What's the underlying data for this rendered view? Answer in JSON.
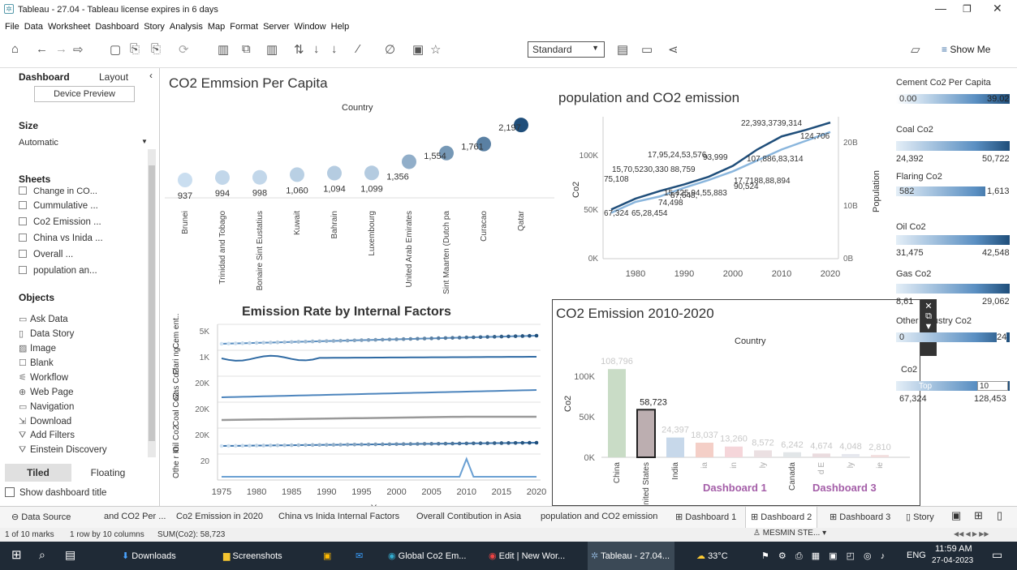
{
  "window": {
    "title": "Tableau - 27.04 - Tableau license expires in 6 days"
  },
  "menu": [
    "File",
    "Data",
    "Worksheet",
    "Dashboard",
    "Story",
    "Analysis",
    "Map",
    "Format",
    "Server",
    "Window",
    "Help"
  ],
  "toolbar": {
    "view_select": "Standard",
    "show_me": "Show Me"
  },
  "left": {
    "tab_dashboard": "Dashboard",
    "tab_layout": "Layout",
    "device_preview": "Device Preview",
    "size_h": "Size",
    "size_val": "Automatic",
    "sheets_h": "Sheets",
    "sheets": [
      "Change in CO...",
      "Cummulative ...",
      "Co2 Emission ...",
      "China vs Inida ...",
      "Overall ...",
      "population an..."
    ],
    "objects_h": "Objects",
    "objects": [
      {
        "icon": "ask-data-icon",
        "label": "Ask Data"
      },
      {
        "icon": "data-story-icon",
        "label": "Data Story"
      },
      {
        "icon": "image-icon",
        "label": "Image"
      },
      {
        "icon": "blank-icon",
        "label": "Blank"
      },
      {
        "icon": "workflow-icon",
        "label": "Workflow"
      },
      {
        "icon": "web-page-icon",
        "label": "Web Page"
      },
      {
        "icon": "navigation-icon",
        "label": "Navigation"
      },
      {
        "icon": "download-icon",
        "label": "Download"
      },
      {
        "icon": "add-filters-icon",
        "label": "Add Filters"
      },
      {
        "icon": "einstein-icon",
        "label": "Einstein Discovery"
      }
    ],
    "tiled": "Tiled",
    "floating": "Floating",
    "show_title": "Show dashboard title"
  },
  "chart1": {
    "title": "CO2 Emmsion Per Capita",
    "header": "Country"
  },
  "chart2": {
    "title": "population and CO2 emission",
    "ylabel": "Co2",
    "y2label": "Population"
  },
  "chart3": {
    "title": "Emission Rate by Internal Factors",
    "xlabel": "Year"
  },
  "chart4": {
    "title": "CO2 Emission 2010-2020",
    "header": "Country",
    "ylabel": "Co2",
    "overlay1": "Dashboard 1",
    "overlay2": "Dashboard 3"
  },
  "chart_data": [
    {
      "type": "scatter",
      "title": "CO2 Emmsion Per Capita",
      "categories": [
        "Brunei",
        "Trinidad and Tobago",
        "Bonaire Sint Eustatius and Saba",
        "Kuwait",
        "Bahrain",
        "Luxembourg",
        "United Arab Emirates",
        "Sint Maarten (Dutch part)",
        "Curacao",
        "Qatar"
      ],
      "values": [
        937,
        994,
        998,
        1060,
        1094,
        1099,
        1356,
        1554,
        1761,
        2197
      ],
      "labels": [
        "937",
        "994",
        "998",
        "1,060",
        "1,094",
        "1,099",
        "1,356",
        "1,554",
        "1,761",
        "2,197"
      ]
    },
    {
      "type": "line",
      "title": "population and CO2 emission",
      "x": [
        1975,
        1980,
        1985,
        1990,
        1995,
        2000,
        2005,
        2010,
        2015,
        2020
      ],
      "xticks": [
        "1980",
        "1990",
        "2000",
        "2010",
        "2020"
      ],
      "yticks": [
        "0K",
        "50K",
        "100K"
      ],
      "y2ticks": [
        "0B",
        "10B",
        "20B"
      ],
      "ylim": [
        0,
        130000
      ],
      "series": [
        {
          "values": [
            45000,
            55000,
            62000,
            68000,
            75000,
            85000,
            100000,
            112000,
            118000,
            124706
          ]
        },
        {
          "values": [
            42000,
            52000,
            57000,
            65000,
            72000,
            80000,
            90000,
            100000,
            108000,
            116000
          ]
        }
      ],
      "annotations": [
        "22,393,3739,314",
        "124,706",
        "17,95,24,53,576,",
        "93,999",
        "15,70,5230,330",
        "88,759",
        "107,886,83,314",
        "75,108",
        "17,7188,88,894",
        "87,648,",
        "90,524",
        "74,498",
        "15,425,94,55,883",
        "67,324",
        "65,28,454"
      ]
    },
    {
      "type": "line",
      "title": "Emission Rate by Internal Factors",
      "xlabel": "Year",
      "xticks": [
        "1975",
        "1980",
        "1985",
        "1990",
        "1995",
        "2000",
        "2005",
        "2010",
        "2015",
        "2020"
      ],
      "panels": [
        {
          "label": "Cem ent..",
          "tick": "5K"
        },
        {
          "label": "Flari ng ..",
          "tick": "1K"
        },
        {
          "label": "Gas Co2",
          "tick": "20K"
        },
        {
          "label": "Coal Co2",
          "tick": "20K"
        },
        {
          "label": "Oil Co2",
          "tick": "20K"
        },
        {
          "label": "Othe r In..",
          "tick": "20"
        }
      ]
    },
    {
      "type": "bar",
      "title": "CO2 Emission 2010-2020",
      "categories": [
        "China",
        "United States",
        "India",
        "ia",
        "in",
        "ly",
        "Canada",
        "d E",
        "ly",
        "ie"
      ],
      "values": [
        108796,
        58723,
        24397,
        18037,
        13260,
        8572,
        6242,
        4674,
        4048,
        2810
      ],
      "labels": [
        "108,796",
        "58,723",
        "24,397",
        "18,037",
        "13,260",
        "8,572",
        "6,242",
        "4,674",
        "4,048",
        "2,810"
      ],
      "yticks": [
        "0K",
        "50K",
        "100K"
      ]
    }
  ],
  "legends": [
    {
      "title": "Cement Co2 Per Capita",
      "min": "0.00",
      "max": "39.02"
    },
    {
      "title": "Coal Co2",
      "min": "24,392",
      "max": "50,722"
    },
    {
      "title": "Flaring Co2",
      "min": "582",
      "max": "1,613"
    },
    {
      "title": "Oil Co2",
      "min": "31,475",
      "max": "42,548"
    },
    {
      "title": "Gas Co2",
      "min": "8,61",
      "max": "29,062"
    },
    {
      "title": "Other Industry Co2",
      "min": "0",
      "max": "24"
    },
    {
      "title": "Co2",
      "min": "67,324",
      "max": "128,453",
      "filter_label": "Top",
      "filter_val": "10"
    }
  ],
  "tabs": [
    "Data Source",
    "and CO2 Per ...",
    "Co2 Emission in 2020",
    "China vs Inida Internal Factors",
    "Overall Contibution in Asia",
    "population and CO2 emission",
    "Dashboard 1",
    "Dashboard 2",
    "Dashboard 3",
    "Story"
  ],
  "status": {
    "marks": "1 of 10 marks",
    "rows": "1 row by 10 columns",
    "sum": "SUM(Co2): 58,723",
    "user": "MESMIN STE..."
  },
  "taskbar": {
    "items": [
      "Downloads",
      "Screenshots",
      "Global Co2 Em...",
      "Edit | New Wor...",
      "Tableau - 27.04..."
    ],
    "temp": "33°C",
    "lang": "ENG",
    "time": "11:59 AM",
    "date": "27-04-2023"
  }
}
